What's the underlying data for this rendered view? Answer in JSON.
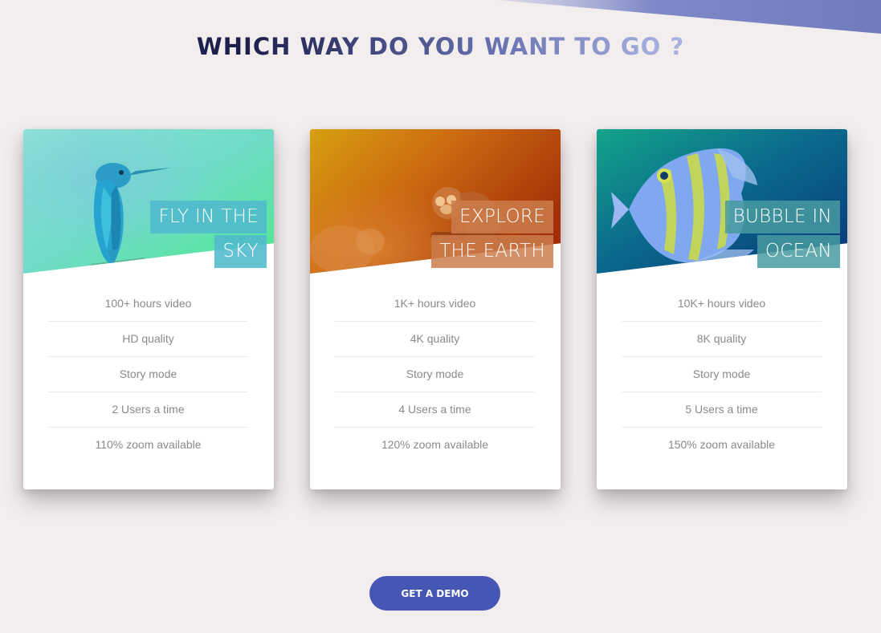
{
  "page": {
    "heading": "WHICH WAY DO YOU WANT TO GO ?"
  },
  "cards": [
    {
      "tag_line1": "FLY IN THE",
      "tag_line2": "SKY",
      "image_subject": "kingfisher",
      "features": [
        "100+ hours video",
        "HD quality",
        "Story mode",
        "2 Users a time",
        "110% zoom available"
      ]
    },
    {
      "tag_line1": "EXPLORE",
      "tag_line2": "THE EARTH",
      "image_subject": "monkey",
      "features": [
        "1K+ hours video",
        "4K quality",
        "Story mode",
        "4 Users a time",
        "120% zoom available"
      ]
    },
    {
      "tag_line1": "BUBBLE IN",
      "tag_line2": "OCEAN",
      "image_subject": "tropical-fish",
      "features": [
        "10K+ hours video",
        "8K quality",
        "Story mode",
        "5 Users a time",
        "150% zoom available"
      ]
    }
  ],
  "cta": {
    "label": "GET A DEMO"
  },
  "colors": {
    "background": "#f3eeee",
    "heading_dark": "#1d1f4d",
    "heading_light": "#c9d0f0",
    "button": "#4556b5",
    "feature_text": "#8a8a8a"
  }
}
